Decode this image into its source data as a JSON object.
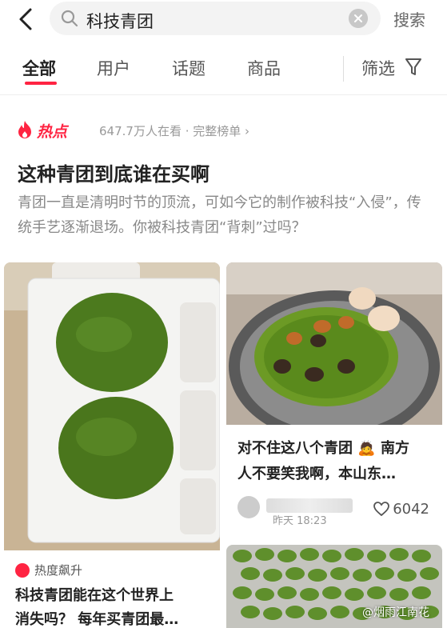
{
  "search": {
    "query": "科技青团",
    "button": "搜索"
  },
  "tabs": [
    {
      "label": "全部",
      "active": true
    },
    {
      "label": "用户",
      "active": false
    },
    {
      "label": "话题",
      "active": false
    },
    {
      "label": "商品",
      "active": false
    }
  ],
  "filter": {
    "label": "筛选"
  },
  "hot": {
    "label": "热点",
    "meta": "647.7万人在看 · 完整榜单 ›"
  },
  "headline": "这种青团到底谁在买啊",
  "description": "青团一直是清明时节的顶流，可如今它的制作被科技“入侵”，传统手艺逐渐退场。你被科技青团“背刺”过吗？",
  "cards": [
    {
      "tag": "热度飙升",
      "title_line1": "科技青团能在这个世界上",
      "title_line2": "消失吗？ 每年买青团最…"
    },
    {
      "title_line1": "对不住这八个青团 🙇 南方",
      "title_line2": "人不要笑我啊，本山东…",
      "time": "昨天 18:23",
      "likes": "6042"
    }
  ],
  "watermark": "@烟雨江南花",
  "colors": {
    "accent": "#ff2442",
    "tea_green": "#4c7a1e"
  }
}
